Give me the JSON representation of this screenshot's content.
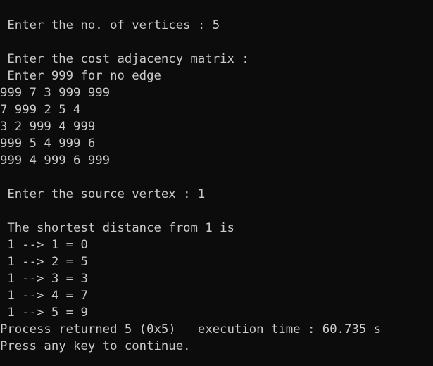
{
  "console": {
    "lines": [
      " Enter the no. of vertices : 5",
      "",
      " Enter the cost adjacency matrix :",
      " Enter 999 for no edge",
      "999 7 3 999 999",
      "7 999 2 5 4",
      "3 2 999 4 999",
      "999 5 4 999 6",
      "999 4 999 6 999",
      "",
      " Enter the source vertex : 1",
      "",
      " The shortest distance from 1 is",
      " 1 --> 1 = 0",
      " 1 --> 2 = 5",
      " 1 --> 3 = 3",
      " 1 --> 4 = 7",
      " 1 --> 5 = 9",
      "Process returned 5 (0x5)   execution time : 60.735 s",
      "Press any key to continue."
    ]
  }
}
